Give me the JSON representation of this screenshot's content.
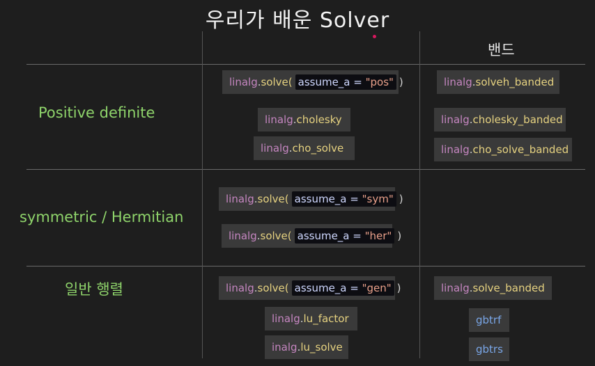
{
  "title": "우리가 배운 Solver",
  "column_header": "밴드",
  "rows": {
    "pos": "Positive definite",
    "sym": "symmetric / Hermitian",
    "gen": "일반 행렬"
  },
  "code": {
    "module": "linalg",
    "dot": ".",
    "param": "assume_a = ",
    "close": ")",
    "solve": "solve(",
    "cholesky": "cholesky",
    "cho_solve": "cho_solve",
    "solveh_banded": "solveh_banded",
    "cholesky_banded": "cholesky_banded",
    "cho_solve_banded": "cho_solve_banded",
    "lu_factor": "lu_factor",
    "solve_banded": "solve_banded",
    "lu_solve_prefix": "inalg",
    "lu_solve": "lu_solve",
    "val_pos": "\"pos\"",
    "val_sym": "\"sym\"",
    "val_her": "\"her\"",
    "val_gen": "\"gen\"",
    "gbtrf": "gbtrf",
    "gbtrs": "gbtrs"
  },
  "colors": {
    "row_label": "#8fd46b",
    "module": "#c586c0",
    "function": "#e6d280",
    "lapack": "#7aa7e8",
    "accent_dot": "#d6185e"
  }
}
